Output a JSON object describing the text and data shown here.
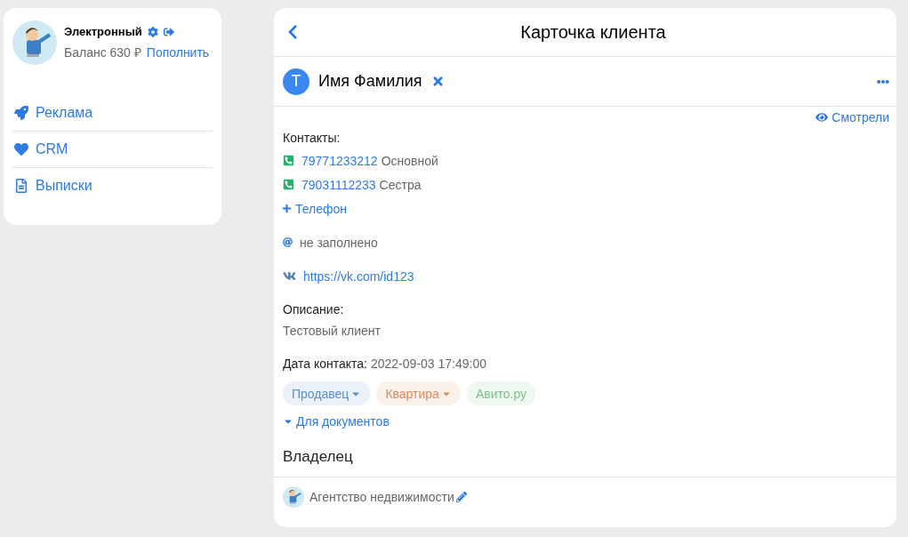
{
  "account": {
    "name": "Электронный",
    "balance_label": "Баланс 630 ₽",
    "top_up": "Пополнить"
  },
  "nav": [
    {
      "label": "Реклама"
    },
    {
      "label": "CRM"
    },
    {
      "label": "Выписки"
    }
  ],
  "card": {
    "title": "Карточка клиента",
    "avatar_letter": "Т",
    "client_name": "Имя Фамилия",
    "viewed": "Смотрели",
    "contacts_label": "Контакты:",
    "phones": [
      {
        "number": "79771233212",
        "note": "Основной"
      },
      {
        "number": "79031112233",
        "note": "Сестра"
      }
    ],
    "add_phone": "Телефон",
    "email": "не заполнено",
    "vk": "https://vk.com/id123",
    "description_label": "Описание:",
    "description": "Тестовый клиент",
    "contact_date_label": "Дата контакта:",
    "contact_date": "2022-09-03 17:49:00",
    "tags": [
      {
        "label": "Продавец",
        "color": "#5b8fd0",
        "dropdown": true
      },
      {
        "label": "Квартира",
        "color": "#d98a5e",
        "dropdown": true
      },
      {
        "label": "Авито.ру",
        "color": "#7fc08d",
        "dropdown": false
      }
    ],
    "documents_toggle": "Для документов",
    "owner_heading": "Владелец",
    "owner_name": "Агентство недвижимости"
  }
}
